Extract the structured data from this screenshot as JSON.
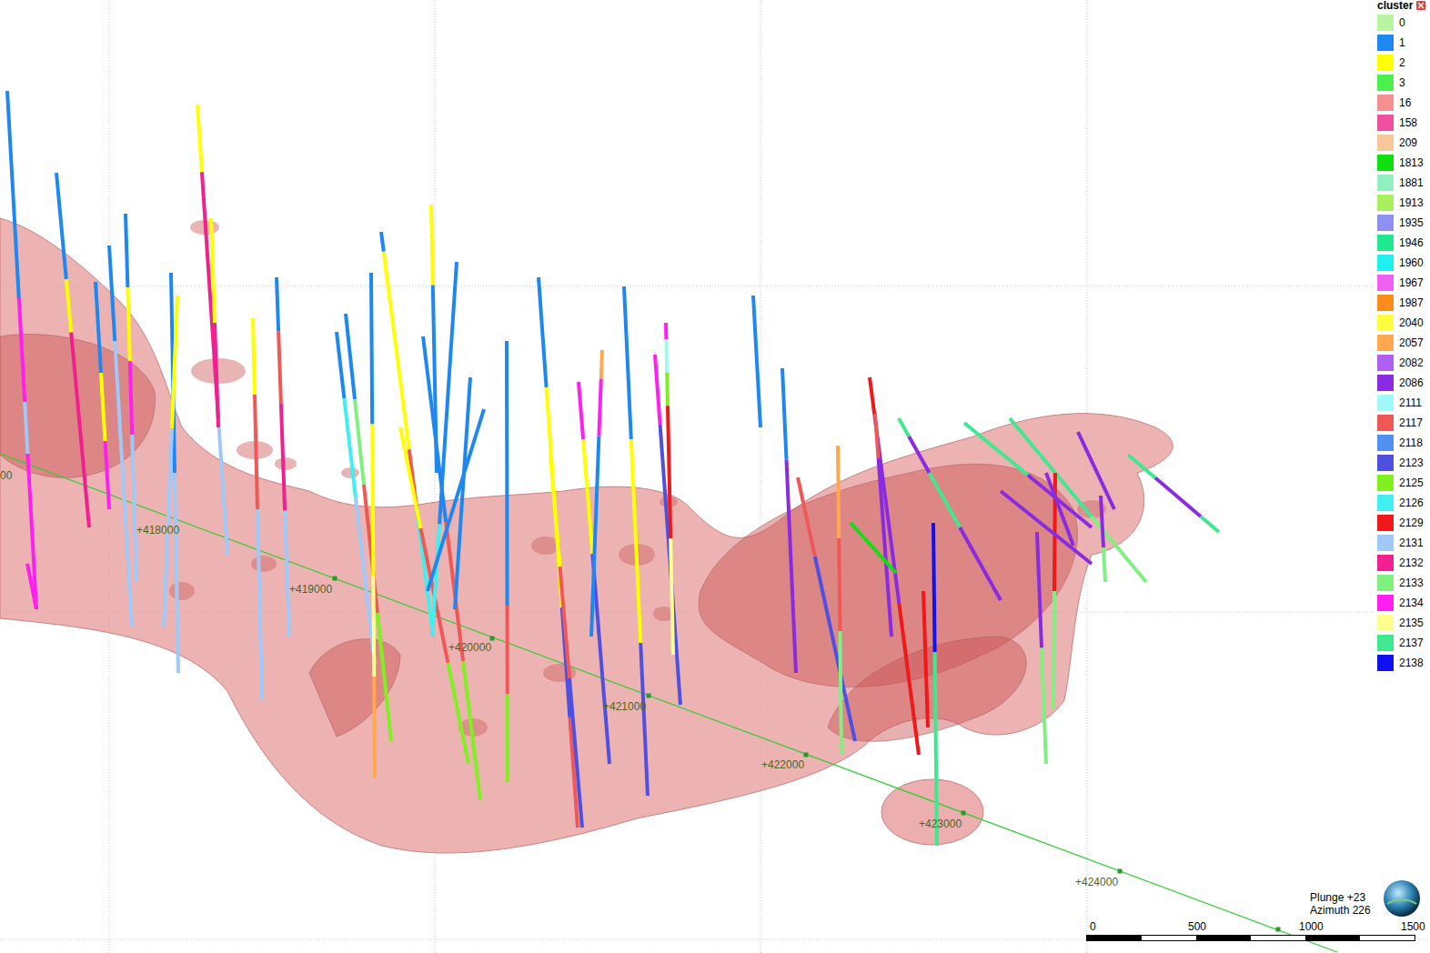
{
  "legend": {
    "title": "cluster",
    "items": [
      {
        "label": "0",
        "color": "#b9f5a0"
      },
      {
        "label": "1",
        "color": "#1e88f0"
      },
      {
        "label": "2",
        "color": "#ffff00"
      },
      {
        "label": "3",
        "color": "#4cf04c"
      },
      {
        "label": "16",
        "color": "#f59090"
      },
      {
        "label": "158",
        "color": "#f050a0"
      },
      {
        "label": "209",
        "color": "#f8c898"
      },
      {
        "label": "1813",
        "color": "#10e010"
      },
      {
        "label": "1881",
        "color": "#90f0c0"
      },
      {
        "label": "1913",
        "color": "#a8f060"
      },
      {
        "label": "1935",
        "color": "#9090f0"
      },
      {
        "label": "1946",
        "color": "#20e890"
      },
      {
        "label": "1960",
        "color": "#20f0f0"
      },
      {
        "label": "1967",
        "color": "#f060f0"
      },
      {
        "label": "1987",
        "color": "#ff8c1a"
      },
      {
        "label": "2040",
        "color": "#ffff40"
      },
      {
        "label": "2057",
        "color": "#ffa850"
      },
      {
        "label": "2082",
        "color": "#b060f0"
      },
      {
        "label": "2086",
        "color": "#8a2be2"
      },
      {
        "label": "2111",
        "color": "#a0f8f8"
      },
      {
        "label": "2117",
        "color": "#f05858"
      },
      {
        "label": "2118",
        "color": "#5090f0"
      },
      {
        "label": "2123",
        "color": "#5050e0"
      },
      {
        "label": "2125",
        "color": "#80f020"
      },
      {
        "label": "2126",
        "color": "#40f0f0"
      },
      {
        "label": "2129",
        "color": "#f01818"
      },
      {
        "label": "2131",
        "color": "#a0c8f8"
      },
      {
        "label": "2132",
        "color": "#f02090"
      },
      {
        "label": "2133",
        "color": "#80f080"
      },
      {
        "label": "2134",
        "color": "#ff20f0"
      },
      {
        "label": "2135",
        "color": "#ffff90"
      },
      {
        "label": "2137",
        "color": "#40e890"
      },
      {
        "label": "2138",
        "color": "#1010f0"
      }
    ]
  },
  "axis": {
    "labels": [
      {
        "text": "00"
      },
      {
        "text": "+418000"
      },
      {
        "text": "+419000"
      },
      {
        "text": "+420000"
      },
      {
        "text": "+421000"
      },
      {
        "text": "+422000"
      },
      {
        "text": "+423000"
      },
      {
        "text": "+424000"
      }
    ]
  },
  "scale_bar": {
    "labels": [
      "0",
      "500",
      "1000",
      "1500"
    ]
  },
  "orientation": {
    "plunge": "Plunge +23",
    "azimuth": "Azimuth 226"
  },
  "drillholes": [
    {
      "trace": [
        8,
        100,
        40,
        670
      ],
      "segments": [
        {
          "cluster": "1",
          "length": 0.4
        },
        {
          "cluster": "2134",
          "length": 0.2
        },
        {
          "cluster": "2131",
          "length": 0.1
        },
        {
          "cluster": "2134",
          "length": 0.3
        }
      ]
    },
    {
      "trace": [
        62,
        190,
        98,
        580
      ],
      "segments": [
        {
          "cluster": "1",
          "length": 0.3
        },
        {
          "cluster": "2",
          "length": 0.15
        },
        {
          "cluster": "2132",
          "length": 0.55
        }
      ]
    },
    {
      "trace": [
        120,
        270,
        145,
        690
      ],
      "segments": [
        {
          "cluster": "1",
          "length": 0.25
        },
        {
          "cluster": "2131",
          "length": 0.75
        }
      ]
    },
    {
      "trace": [
        138,
        235,
        150,
        640
      ],
      "segments": [
        {
          "cluster": "1",
          "length": 0.2
        },
        {
          "cluster": "2",
          "length": 0.2
        },
        {
          "cluster": "2134",
          "length": 0.2
        },
        {
          "cluster": "2131",
          "length": 0.4
        }
      ]
    },
    {
      "trace": [
        105,
        310,
        120,
        560
      ],
      "segments": [
        {
          "cluster": "1",
          "length": 0.4
        },
        {
          "cluster": "2",
          "length": 0.3
        },
        {
          "cluster": "2134",
          "length": 0.3
        }
      ]
    },
    {
      "trace": [
        188,
        300,
        196,
        740
      ],
      "segments": [
        {
          "cluster": "1",
          "length": 0.5
        },
        {
          "cluster": "2131",
          "length": 0.5
        }
      ]
    },
    {
      "trace": [
        195,
        325,
        180,
        690
      ],
      "segments": [
        {
          "cluster": "2",
          "length": 0.4
        },
        {
          "cluster": "2131",
          "length": 0.6
        }
      ]
    },
    {
      "trace": [
        217,
        115,
        250,
        610
      ],
      "segments": [
        {
          "cluster": "2",
          "length": 0.15
        },
        {
          "cluster": "2132",
          "length": 0.55
        },
        {
          "cluster": "2131",
          "length": 0.3
        }
      ]
    },
    {
      "trace": [
        232,
        240,
        240,
        470
      ],
      "segments": [
        {
          "cluster": "2",
          "length": 0.5
        },
        {
          "cluster": "2132",
          "length": 0.5
        }
      ]
    },
    {
      "trace": [
        278,
        350,
        288,
        770
      ],
      "segments": [
        {
          "cluster": "2",
          "length": 0.2
        },
        {
          "cluster": "2117",
          "length": 0.3
        },
        {
          "cluster": "2131",
          "length": 0.5
        }
      ]
    },
    {
      "trace": [
        304,
        305,
        318,
        700
      ],
      "segments": [
        {
          "cluster": "1",
          "length": 0.15
        },
        {
          "cluster": "2117",
          "length": 0.2
        },
        {
          "cluster": "2132",
          "length": 0.3
        },
        {
          "cluster": "2131",
          "length": 0.35
        }
      ]
    },
    {
      "trace": [
        370,
        365,
        412,
        730
      ],
      "segments": [
        {
          "cluster": "1",
          "length": 0.2
        },
        {
          "cluster": "2126",
          "length": 0.3
        },
        {
          "cluster": "2131",
          "length": 0.5
        }
      ]
    },
    {
      "trace": [
        380,
        345,
        430,
        815
      ],
      "segments": [
        {
          "cluster": "1",
          "length": 0.2
        },
        {
          "cluster": "2133",
          "length": 0.2
        },
        {
          "cluster": "2117",
          "length": 0.3
        },
        {
          "cluster": "2125",
          "length": 0.3
        }
      ]
    },
    {
      "trace": [
        408,
        300,
        412,
        855
      ],
      "segments": [
        {
          "cluster": "1",
          "length": 0.3
        },
        {
          "cluster": "2",
          "length": 0.3
        },
        {
          "cluster": "2135",
          "length": 0.2
        },
        {
          "cluster": "2057",
          "length": 0.2
        }
      ]
    },
    {
      "trace": [
        419,
        255,
        475,
        690
      ],
      "segments": [
        {
          "cluster": "1",
          "length": 0.05
        },
        {
          "cluster": "2",
          "length": 0.5
        },
        {
          "cluster": "2117",
          "length": 0.15
        },
        {
          "cluster": "2126",
          "length": 0.3
        }
      ]
    },
    {
      "trace": [
        474,
        225,
        480,
        520
      ],
      "segments": [
        {
          "cluster": "2",
          "length": 0.3
        },
        {
          "cluster": "1",
          "length": 0.7
        }
      ]
    },
    {
      "trace": [
        465,
        370,
        528,
        880
      ],
      "segments": [
        {
          "cluster": "1",
          "length": 0.4
        },
        {
          "cluster": "2117",
          "length": 0.3
        },
        {
          "cluster": "2125",
          "length": 0.3
        }
      ]
    },
    {
      "trace": [
        440,
        470,
        515,
        840
      ],
      "segments": [
        {
          "cluster": "2",
          "length": 0.3
        },
        {
          "cluster": "2117",
          "length": 0.4
        },
        {
          "cluster": "2125",
          "length": 0.3
        }
      ]
    },
    {
      "trace": [
        502,
        288,
        475,
        700
      ],
      "segments": [
        {
          "cluster": "1",
          "length": 0.7
        },
        {
          "cluster": "2126",
          "length": 0.3
        }
      ]
    },
    {
      "trace": [
        517,
        415,
        500,
        670
      ],
      "segments": [
        {
          "cluster": "1",
          "length": 1
        }
      ]
    },
    {
      "trace": [
        532,
        450,
        470,
        650
      ],
      "segments": [
        {
          "cluster": "1",
          "length": 1
        }
      ]
    },
    {
      "trace": [
        557,
        375,
        558,
        860
      ],
      "segments": [
        {
          "cluster": "1",
          "length": 0.6
        },
        {
          "cluster": "2117",
          "length": 0.2
        },
        {
          "cluster": "2125",
          "length": 0.2
        }
      ]
    },
    {
      "trace": [
        592,
        305,
        635,
        910
      ],
      "segments": [
        {
          "cluster": "1",
          "length": 0.2
        },
        {
          "cluster": "2",
          "length": 0.4
        },
        {
          "cluster": "2123",
          "length": 0.2
        },
        {
          "cluster": "2117",
          "length": 0.2
        }
      ]
    },
    {
      "trace": [
        605,
        500,
        640,
        910
      ],
      "segments": [
        {
          "cluster": "2",
          "length": 0.3
        },
        {
          "cluster": "2117",
          "length": 0.3
        },
        {
          "cluster": "2123",
          "length": 0.4
        }
      ]
    },
    {
      "trace": [
        636,
        420,
        670,
        840
      ],
      "segments": [
        {
          "cluster": "2134",
          "length": 0.15
        },
        {
          "cluster": "2",
          "length": 0.3
        },
        {
          "cluster": "2123",
          "length": 0.55
        }
      ]
    },
    {
      "trace": [
        662,
        385,
        650,
        700
      ],
      "segments": [
        {
          "cluster": "2057",
          "length": 0.1
        },
        {
          "cluster": "2134",
          "length": 0.2
        },
        {
          "cluster": "1",
          "length": 0.7
        }
      ]
    },
    {
      "trace": [
        686,
        315,
        712,
        875
      ],
      "segments": [
        {
          "cluster": "1",
          "length": 0.3
        },
        {
          "cluster": "2",
          "length": 0.4
        },
        {
          "cluster": "2123",
          "length": 0.3
        }
      ]
    },
    {
      "trace": [
        720,
        390,
        748,
        775
      ],
      "segments": [
        {
          "cluster": "2134",
          "length": 0.2
        },
        {
          "cluster": "2123",
          "length": 0.8
        }
      ]
    },
    {
      "trace": [
        732,
        355,
        740,
        720
      ],
      "segments": [
        {
          "cluster": "2134",
          "length": 0.05
        },
        {
          "cluster": "2111",
          "length": 0.1
        },
        {
          "cluster": "2125",
          "length": 0.1
        },
        {
          "cluster": "2129",
          "length": 0.4
        },
        {
          "cluster": "2135",
          "length": 0.35
        }
      ]
    },
    {
      "trace": [
        828,
        325,
        836,
        470
      ],
      "segments": [
        {
          "cluster": "1",
          "length": 1
        }
      ]
    },
    {
      "trace": [
        860,
        405,
        875,
        740
      ],
      "segments": [
        {
          "cluster": "1",
          "length": 0.3
        },
        {
          "cluster": "2086",
          "length": 0.7
        }
      ]
    },
    {
      "trace": [
        877,
        525,
        940,
        815
      ],
      "segments": [
        {
          "cluster": "2117",
          "length": 0.3
        },
        {
          "cluster": "2123",
          "length": 0.7
        }
      ]
    },
    {
      "trace": [
        921,
        490,
        925,
        830
      ],
      "segments": [
        {
          "cluster": "2057",
          "length": 0.3
        },
        {
          "cluster": "2117",
          "length": 0.3
        },
        {
          "cluster": "2133",
          "length": 0.4
        }
      ]
    },
    {
      "trace": [
        956,
        415,
        1010,
        830
      ],
      "segments": [
        {
          "cluster": "2129",
          "length": 0.1
        },
        {
          "cluster": "2086",
          "length": 0.5
        },
        {
          "cluster": "2129",
          "length": 0.4
        }
      ]
    },
    {
      "trace": [
        962,
        455,
        980,
        700
      ],
      "segments": [
        {
          "cluster": "2117",
          "length": 0.2
        },
        {
          "cluster": "2086",
          "length": 0.8
        }
      ]
    },
    {
      "trace": [
        988,
        460,
        1100,
        660
      ],
      "segments": [
        {
          "cluster": "2137",
          "length": 0.1
        },
        {
          "cluster": "2086",
          "length": 0.2
        },
        {
          "cluster": "2137",
          "length": 0.3
        },
        {
          "cluster": "2086",
          "length": 0.4
        }
      ]
    },
    {
      "trace": [
        1026,
        575,
        1030,
        930
      ],
      "segments": [
        {
          "cluster": "2138",
          "length": 0.4
        },
        {
          "cluster": "2137",
          "length": 0.6
        }
      ]
    },
    {
      "trace": [
        1015,
        650,
        1020,
        800
      ],
      "segments": [
        {
          "cluster": "2129",
          "length": 1
        }
      ]
    },
    {
      "trace": [
        1060,
        465,
        1200,
        580
      ],
      "segments": [
        {
          "cluster": "2137",
          "length": 0.5
        },
        {
          "cluster": "2086",
          "length": 0.5
        }
      ]
    },
    {
      "trace": [
        1110,
        460,
        1260,
        640
      ],
      "segments": [
        {
          "cluster": "2137",
          "length": 0.6
        },
        {
          "cluster": "2133",
          "length": 0.4
        }
      ]
    },
    {
      "trace": [
        1140,
        585,
        1150,
        840
      ],
      "segments": [
        {
          "cluster": "2086",
          "length": 0.5
        },
        {
          "cluster": "2133",
          "length": 0.5
        }
      ]
    },
    {
      "trace": [
        1160,
        520,
        1158,
        780
      ],
      "segments": [
        {
          "cluster": "2129",
          "length": 0.5
        },
        {
          "cluster": "2133",
          "length": 0.5
        }
      ]
    },
    {
      "trace": [
        1185,
        475,
        1225,
        560
      ],
      "segments": [
        {
          "cluster": "2086",
          "length": 1
        }
      ]
    },
    {
      "trace": [
        1240,
        500,
        1340,
        585
      ],
      "segments": [
        {
          "cluster": "2137",
          "length": 0.3
        },
        {
          "cluster": "2086",
          "length": 0.5
        },
        {
          "cluster": "2137",
          "length": 0.2
        }
      ]
    },
    {
      "trace": [
        935,
        575,
        985,
        630
      ],
      "segments": [
        {
          "cluster": "1813",
          "length": 1
        }
      ]
    },
    {
      "trace": [
        1100,
        540,
        1200,
        620
      ],
      "segments": [
        {
          "cluster": "2086",
          "length": 1
        }
      ]
    },
    {
      "trace": [
        1210,
        545,
        1215,
        640
      ],
      "segments": [
        {
          "cluster": "2086",
          "length": 0.6
        },
        {
          "cluster": "2133",
          "length": 0.4
        }
      ]
    },
    {
      "trace": [
        30,
        620,
        40,
        670
      ],
      "segments": [
        {
          "cluster": "2134",
          "length": 1
        }
      ]
    },
    {
      "trace": [
        1150,
        520,
        1180,
        600
      ],
      "segments": [
        {
          "cluster": "2086",
          "length": 1
        }
      ]
    }
  ]
}
